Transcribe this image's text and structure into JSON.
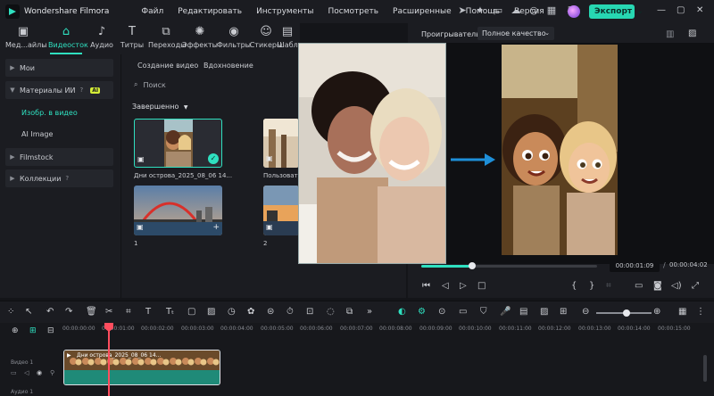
{
  "app": {
    "title": "Wondershare Filmora"
  },
  "menu": [
    "Файл",
    "Редактировать",
    "Инструменты",
    "Посмотреть",
    "Расширенные",
    "Помощь",
    "Версия"
  ],
  "header": {
    "export_label": "Экспорт"
  },
  "toolbar": {
    "tabs": [
      {
        "label": "Мед...айлы",
        "icon": "media-icon"
      },
      {
        "label": "Видеосток",
        "icon": "stock-icon"
      },
      {
        "label": "Аудио",
        "icon": "audio-icon"
      },
      {
        "label": "Титры",
        "icon": "title-icon"
      },
      {
        "label": "Переходы",
        "icon": "transition-icon"
      },
      {
        "label": "Эффекты",
        "icon": "effects-icon"
      },
      {
        "label": "Фильтры",
        "icon": "filter-icon"
      },
      {
        "label": "Стикеры",
        "icon": "sticker-icon"
      },
      {
        "label": "Шабл",
        "icon": "template-icon"
      }
    ],
    "active_tab": "Видеосток"
  },
  "sidebar": {
    "items": [
      {
        "label": "Мои"
      },
      {
        "label": "Материалы ИИ",
        "badge": "AI"
      },
      {
        "label": "Изобр. в видео",
        "sub": true,
        "active": true
      },
      {
        "label": "AI Image",
        "sub": true
      },
      {
        "label": "Filmstock"
      },
      {
        "label": "Коллекции"
      }
    ]
  },
  "media": {
    "subtabs": [
      "Создание видео",
      "Вдохновение"
    ],
    "search_placeholder": "Поиск",
    "filter_label": "Завершенно",
    "items": [
      {
        "label": "Дни острова_2025_08_06 14..."
      },
      {
        "label": "Пользовате"
      },
      {
        "label": "1"
      },
      {
        "label": "2"
      }
    ]
  },
  "player": {
    "tab_label": "Проигрыватель",
    "quality": "Полное качество",
    "current_time": "00:00:01:09",
    "separator": "/",
    "total_time": "00:00:04:02",
    "progress": 0.29
  },
  "timeline": {
    "ruler": [
      "00:00:00:00",
      "00:00:01:00",
      "00:00:02:00",
      "00:00:03:00",
      "00:00:04:00",
      "00:00:05:00",
      "00:00:06:00",
      "00:00:07:00",
      "00:00:08:00",
      "00:00:09:00",
      "00:00:10:00",
      "00:00:11:00",
      "00:00:12:00",
      "00:00:13:00",
      "00:00:14:00",
      "00:00:15:00"
    ],
    "track_video_label": "Видео 1",
    "track_audio_label": "Аудио 1",
    "clip_title": "Дни острова_2025_08_06 14..."
  },
  "colors": {
    "accent": "#2fe0c0",
    "export": "#27d7b2",
    "playhead": "#ff4d5e",
    "ai_badge": "#d6ef37"
  }
}
